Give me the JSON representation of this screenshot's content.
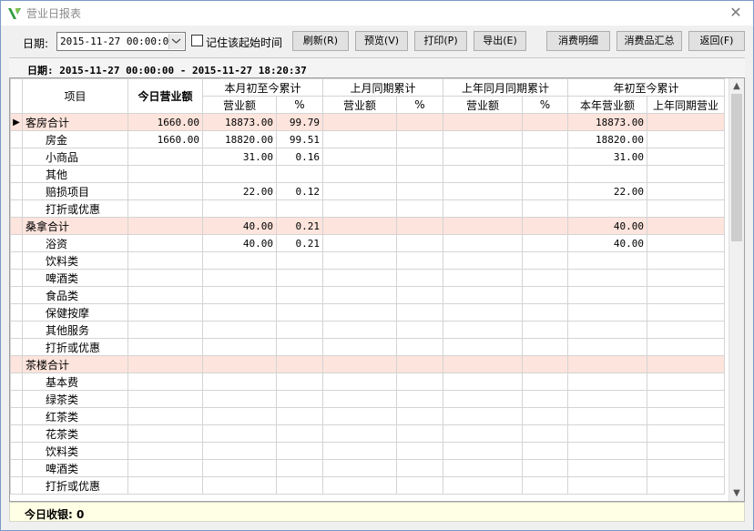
{
  "window": {
    "title": "营业日报表",
    "close_glyph": "✕"
  },
  "toolbar": {
    "date_label": "日期:",
    "date_value": "2015-11-27 00:00:00",
    "remember_label": "记住该起始时间",
    "buttons": {
      "refresh": "刷新(R)",
      "preview": "预览(V)",
      "print": "打印(P)",
      "export": "导出(E)",
      "consume_detail": "消费明细",
      "goods_summary": "消费品汇总",
      "back": "返回(F)"
    }
  },
  "range_text": "日期: 2015-11-27 00:00:00 - 2015-11-27 18:20:37",
  "columns": {
    "item": "项目",
    "today": "今日营业额",
    "month_to_date": "本月初至今累计",
    "last_month_same": "上月同期累计",
    "last_year_month_same": "上年同月同期累计",
    "year_to_date": "年初至今累计",
    "amount": "营业额",
    "pct": "%",
    "year_amount": "本年营业额",
    "last_year_same": "上年同期营业"
  },
  "rows": [
    {
      "name": "客房合计",
      "total": true,
      "today": "1660.00",
      "m_amt": "18873.00",
      "m_pct": "99.79",
      "y_amt": "18873.00",
      "marker": "▶"
    },
    {
      "name": "房金",
      "today": "1660.00",
      "m_amt": "18820.00",
      "m_pct": "99.51",
      "y_amt": "18820.00"
    },
    {
      "name": "小商品",
      "m_amt": "31.00",
      "m_pct": "0.16",
      "y_amt": "31.00"
    },
    {
      "name": "其他"
    },
    {
      "name": "赔损项目",
      "m_amt": "22.00",
      "m_pct": "0.12",
      "y_amt": "22.00"
    },
    {
      "name": "打折或优惠"
    },
    {
      "name": "桑拿合计",
      "total": true,
      "m_amt": "40.00",
      "m_pct": "0.21",
      "y_amt": "40.00"
    },
    {
      "name": "浴资",
      "m_amt": "40.00",
      "m_pct": "0.21",
      "y_amt": "40.00"
    },
    {
      "name": "饮料类"
    },
    {
      "name": "啤酒类"
    },
    {
      "name": "食品类"
    },
    {
      "name": "保健按摩"
    },
    {
      "name": "其他服务"
    },
    {
      "name": "打折或优惠"
    },
    {
      "name": "茶楼合计",
      "total": true
    },
    {
      "name": "基本费"
    },
    {
      "name": "绿茶类"
    },
    {
      "name": "红茶类"
    },
    {
      "name": "花茶类"
    },
    {
      "name": "饮料类"
    },
    {
      "name": "啤酒类"
    },
    {
      "name": "打折或优惠"
    }
  ],
  "footer": {
    "text": "今日收银: 0"
  }
}
